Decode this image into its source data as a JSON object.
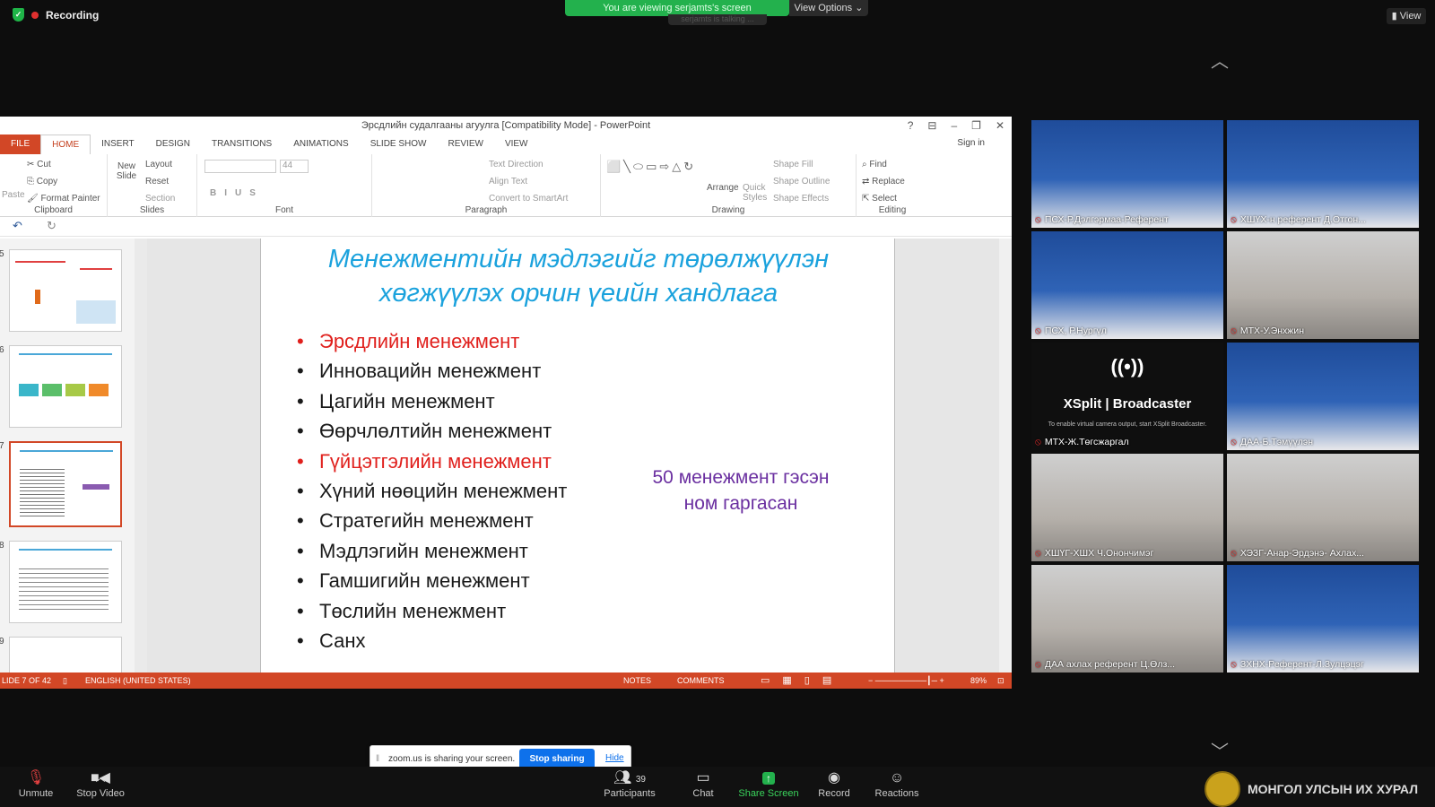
{
  "zoom": {
    "recording_label": "Recording",
    "viewing_banner": "You are viewing serjamts's screen",
    "view_options": "View Options",
    "talking": "serjamts is talking ...",
    "view_button": "View",
    "share_banner": {
      "text": "zoom.us is sharing your screen.",
      "stop": "Stop sharing",
      "hide": "Hide"
    },
    "toolbar": {
      "unmute": "Unmute",
      "stop_video": "Stop Video",
      "participants": "Participants",
      "participants_count": "39",
      "chat": "Chat",
      "share_screen": "Share Screen",
      "record": "Record",
      "reactions": "Reactions"
    },
    "watermark": "МОНГОЛ УЛСЫН ИХ ХУРАЛ",
    "participants": [
      "ПСХ-Р.Дэлгэрмаа-Референт",
      "ХШҮХ-н референт Д.Отгон...",
      "ПСХ, Р.Нургүл",
      "МТХ-У.Энхжин",
      "МТХ-Ж.Төгсжаргал",
      "ДАА-Б.Тэмүүлэн",
      "ХШҮГ-ХШХ Ч.Онончимэг",
      "ХЭЗГ-Анар-Эрдэнэ- Ахлах...",
      "ДАА ахлах референт Ц.Өлз...",
      "ЗХНХ-Референт-Л.Зулцэцэг"
    ],
    "xsplit": {
      "title": "XSplit | Broadcaster",
      "note": "To enable virtual camera output, start XSplit Broadcaster."
    }
  },
  "ppt": {
    "window_title": "Эрсдлийн судалгааны агуулга [Compatibility Mode] - PowerPoint",
    "sign_in": "Sign in",
    "tabs": [
      "FILE",
      "HOME",
      "INSERT",
      "DESIGN",
      "TRANSITIONS",
      "ANIMATIONS",
      "SLIDE SHOW",
      "REVIEW",
      "VIEW"
    ],
    "ribbon": {
      "clipboard": {
        "label": "Clipboard",
        "paste": "Paste",
        "cut": "Cut",
        "copy": "Copy",
        "format_painter": "Format Painter"
      },
      "slides": {
        "label": "Slides",
        "new_slide": "New Slide",
        "layout": "Layout",
        "reset": "Reset",
        "section": "Section"
      },
      "font": {
        "label": "Font",
        "size": "44"
      },
      "paragraph": {
        "label": "Paragraph",
        "text_direction": "Text Direction",
        "align_text": "Align Text",
        "convert": "Convert to SmartArt"
      },
      "drawing": {
        "label": "Drawing",
        "arrange": "Arrange",
        "quick_styles": "Quick Styles",
        "shape_fill": "Shape Fill",
        "shape_outline": "Shape Outline",
        "shape_effects": "Shape Effects"
      },
      "editing": {
        "label": "Editing",
        "find": "Find",
        "replace": "Replace",
        "select": "Select"
      }
    },
    "thumb_numbers": [
      "5",
      "6",
      "7",
      "8",
      "9"
    ],
    "slide": {
      "title": "Менежментийн мэдлэгийг  төрөлжүүлэн хөгжүүлэх орчин үеийн хандлага",
      "bullets": [
        {
          "text": "Эрсдлийн менежмент",
          "red": true
        },
        {
          "text": "Инновацийн менежмент",
          "red": false
        },
        {
          "text": "Цагийн менежмент",
          "red": false
        },
        {
          "text": "Өөрчлөлтийн менежмент",
          "red": false
        },
        {
          "text": "Гүйцэтгэлийн менежмент",
          "red": true
        },
        {
          "text": "Хүний нөөцийн менежмент",
          "red": false
        },
        {
          "text": "Стратегийн менежмент",
          "red": false
        },
        {
          "text": "Мэдлэгийн менежмент",
          "red": false
        },
        {
          "text": "Гамшигийн менежмент",
          "red": false
        },
        {
          "text": "Төслийн менежмент",
          "red": false
        },
        {
          "text": "Санх",
          "red": false
        }
      ],
      "note": "50 менежмент гэсэн ном гаргасан"
    },
    "status": {
      "slide_of": "LIDE 7 OF 42",
      "language": "ENGLISH (UNITED STATES)",
      "notes": "NOTES",
      "comments": "COMMENTS",
      "zoom": "89%"
    }
  }
}
